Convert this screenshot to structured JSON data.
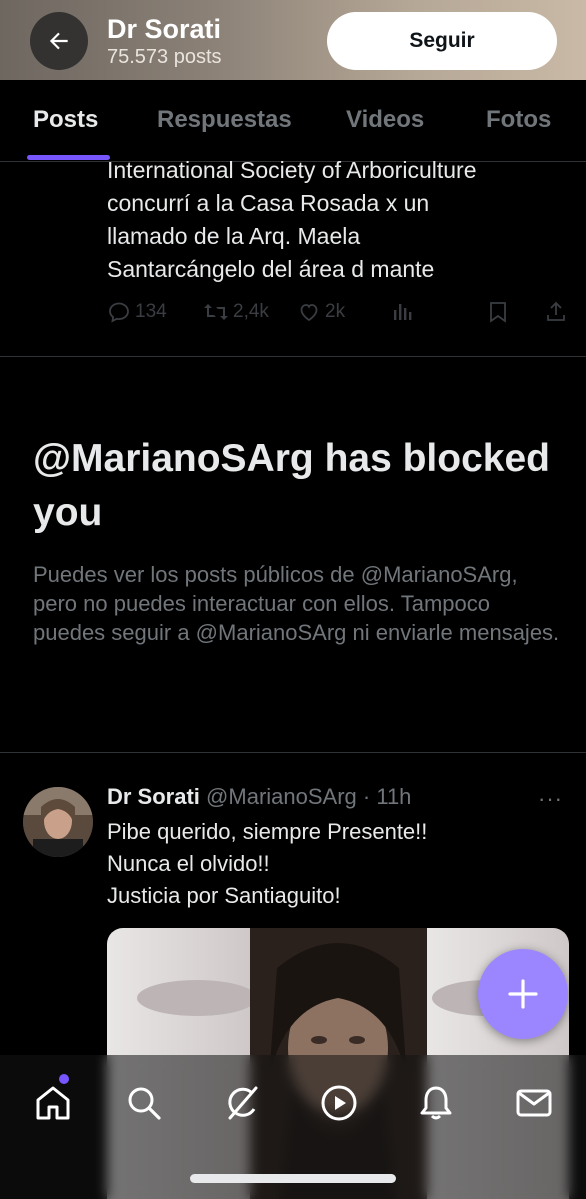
{
  "header": {
    "title": "Dr Sorati",
    "subtitle": "75.573 posts",
    "follow_label": "Seguir",
    "back_icon": "arrow-left-icon"
  },
  "tabs": [
    {
      "label": "Posts",
      "active": true
    },
    {
      "label": "Respuestas",
      "active": false
    },
    {
      "label": "Videos",
      "active": false
    },
    {
      "label": "Fotos",
      "active": false
    }
  ],
  "tweet1": {
    "text_lines": [
      "International Society of Arboriculture",
      "concurrí a la  Casa Rosada x un",
      "llamado de la Arq. Maela",
      "Santarcángelo del área d mante"
    ],
    "replies": "134",
    "reposts": "2,4k",
    "likes": "2k"
  },
  "block_notice": {
    "title": "@MarianoSArg has blocked you",
    "description": "Puedes ver los posts públicos de @MarianoSArg, pero no puedes interactuar con ellos. Tampoco puedes seguir a @MarianoSArg ni enviarle mensajes."
  },
  "tweet2": {
    "name": "Dr Sorati",
    "handle": "@MarianoSArg",
    "time": "· 11h",
    "more": "···",
    "text_lines": [
      "Pibe querido, siempre Presente!!",
      "Nunca el olvido!!",
      "Justicia por Santiaguito!"
    ]
  },
  "nav": {
    "items": [
      "home-icon",
      "search-icon",
      "grok-icon",
      "video-icon",
      "bell-icon",
      "mail-icon"
    ]
  },
  "colors": {
    "accent": "#7856ff",
    "fab": "#9b86ff",
    "muted": "#71767b",
    "background": "#000000"
  }
}
